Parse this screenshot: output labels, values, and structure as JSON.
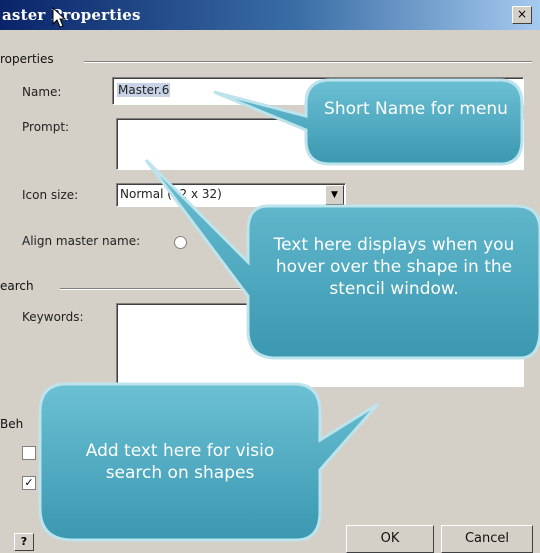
{
  "window": {
    "title": "aster Properties",
    "close_label": "×"
  },
  "properties": {
    "group_label": "roperties",
    "name_label": "Name:",
    "name_value": "Master.6",
    "prompt_label": "Prompt:",
    "icon_size_label": "Icon size:",
    "icon_size_value": "Normal (32 x 32)",
    "align_label": "Align master name:"
  },
  "search": {
    "group_label": "earch",
    "keywords_label": "Keywords:"
  },
  "behavior": {
    "group_label": "Beh"
  },
  "buttons": {
    "help": "?",
    "ok": "OK",
    "cancel": "Cancel"
  },
  "callouts": {
    "name": "Short Name for menu",
    "prompt": "Text here displays when you hover over the shape in the stencil window.",
    "keywords": "Add text here for visio search on shapes"
  },
  "colors": {
    "callout_fill": "#4aa7bd",
    "callout_border": "#2f8aa3",
    "title_bar": "#0a246a"
  }
}
